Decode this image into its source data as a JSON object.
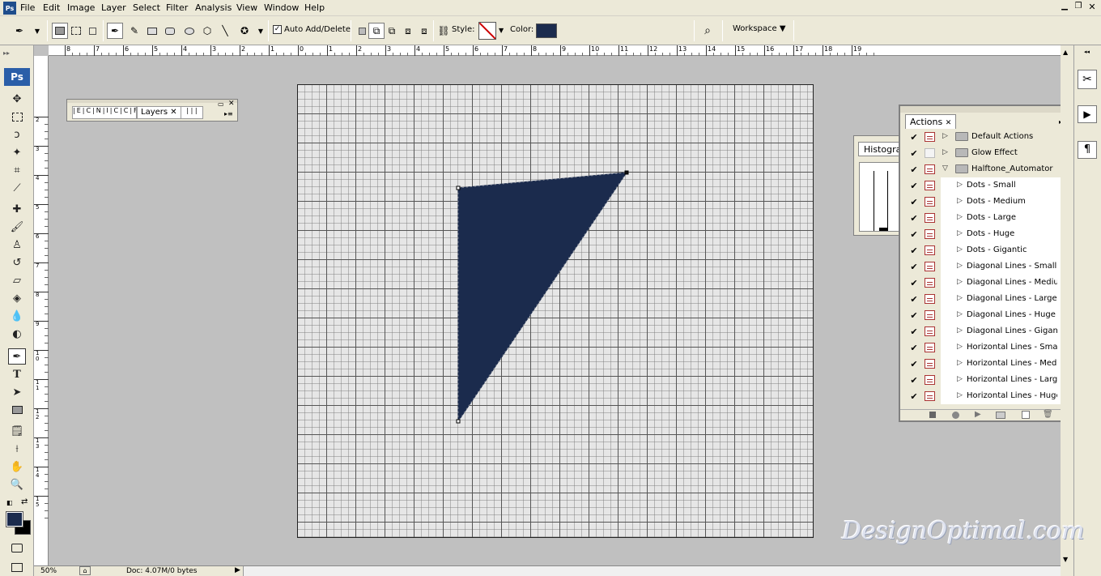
{
  "menu": [
    "File",
    "Edit",
    "Image",
    "Layer",
    "Select",
    "Filter",
    "Analysis",
    "View",
    "Window",
    "Help"
  ],
  "options": {
    "auto_add_delete": "Auto Add/Delete",
    "style_label": "Style:",
    "color_label": "Color:",
    "workspace": "Workspace",
    "fill_color": "#1b2b4d"
  },
  "toolbox": {
    "ps_logo": "Ps"
  },
  "ruler": {
    "h_ticks": [
      "8",
      "7",
      "6",
      "5",
      "4",
      "3",
      "2",
      "1",
      "0",
      "1",
      "2",
      "3",
      "4",
      "5",
      "6",
      "7",
      "8",
      "9",
      "10",
      "11",
      "12",
      "13",
      "14",
      "15",
      "16",
      "17",
      "18",
      "19"
    ],
    "v_ticks": [
      "2",
      "3",
      "4",
      "5",
      "6",
      "7",
      "8",
      "9",
      "1\n0",
      "1\n1",
      "1\n2",
      "1\n3",
      "1\n4",
      "1\n5"
    ]
  },
  "layers_panel": {
    "tab": "Layers"
  },
  "histogram_panel": {
    "tab": "Histogram"
  },
  "actions_panel": {
    "tab": "Actions",
    "rows": [
      {
        "label": "Default Actions",
        "type": "set",
        "open": false,
        "dialog": true
      },
      {
        "label": "Glow Effect",
        "type": "set",
        "open": false,
        "dialog": false
      },
      {
        "label": "Halftone_Automator",
        "type": "set",
        "open": true,
        "dialog": true
      },
      {
        "label": "Dots - Small",
        "type": "action",
        "dialog": true
      },
      {
        "label": "Dots - Medium",
        "type": "action",
        "dialog": true
      },
      {
        "label": "Dots - Large",
        "type": "action",
        "dialog": true
      },
      {
        "label": "Dots - Huge",
        "type": "action",
        "dialog": true
      },
      {
        "label": "Dots - Gigantic",
        "type": "action",
        "dialog": true
      },
      {
        "label": "Diagonal Lines - Small",
        "type": "action",
        "dialog": true
      },
      {
        "label": "Diagonal Lines - Medium",
        "type": "action",
        "dialog": true
      },
      {
        "label": "Diagonal Lines - Large",
        "type": "action",
        "dialog": true
      },
      {
        "label": "Diagonal Lines - Huge",
        "type": "action",
        "dialog": true
      },
      {
        "label": "Diagonal Lines - Gigan...",
        "type": "action",
        "dialog": true
      },
      {
        "label": "Horizontal Lines - Small",
        "type": "action",
        "dialog": true
      },
      {
        "label": "Horizontal Lines - Med...",
        "type": "action",
        "dialog": true
      },
      {
        "label": "Horizontal Lines - Large",
        "type": "action",
        "dialog": true
      },
      {
        "label": "Horizontal Lines - Huge",
        "type": "action",
        "dialog": true
      }
    ]
  },
  "status": {
    "zoom": "50%",
    "doc": "Doc: 4.07M/0 bytes"
  },
  "watermark": "DesignOptimal.com"
}
